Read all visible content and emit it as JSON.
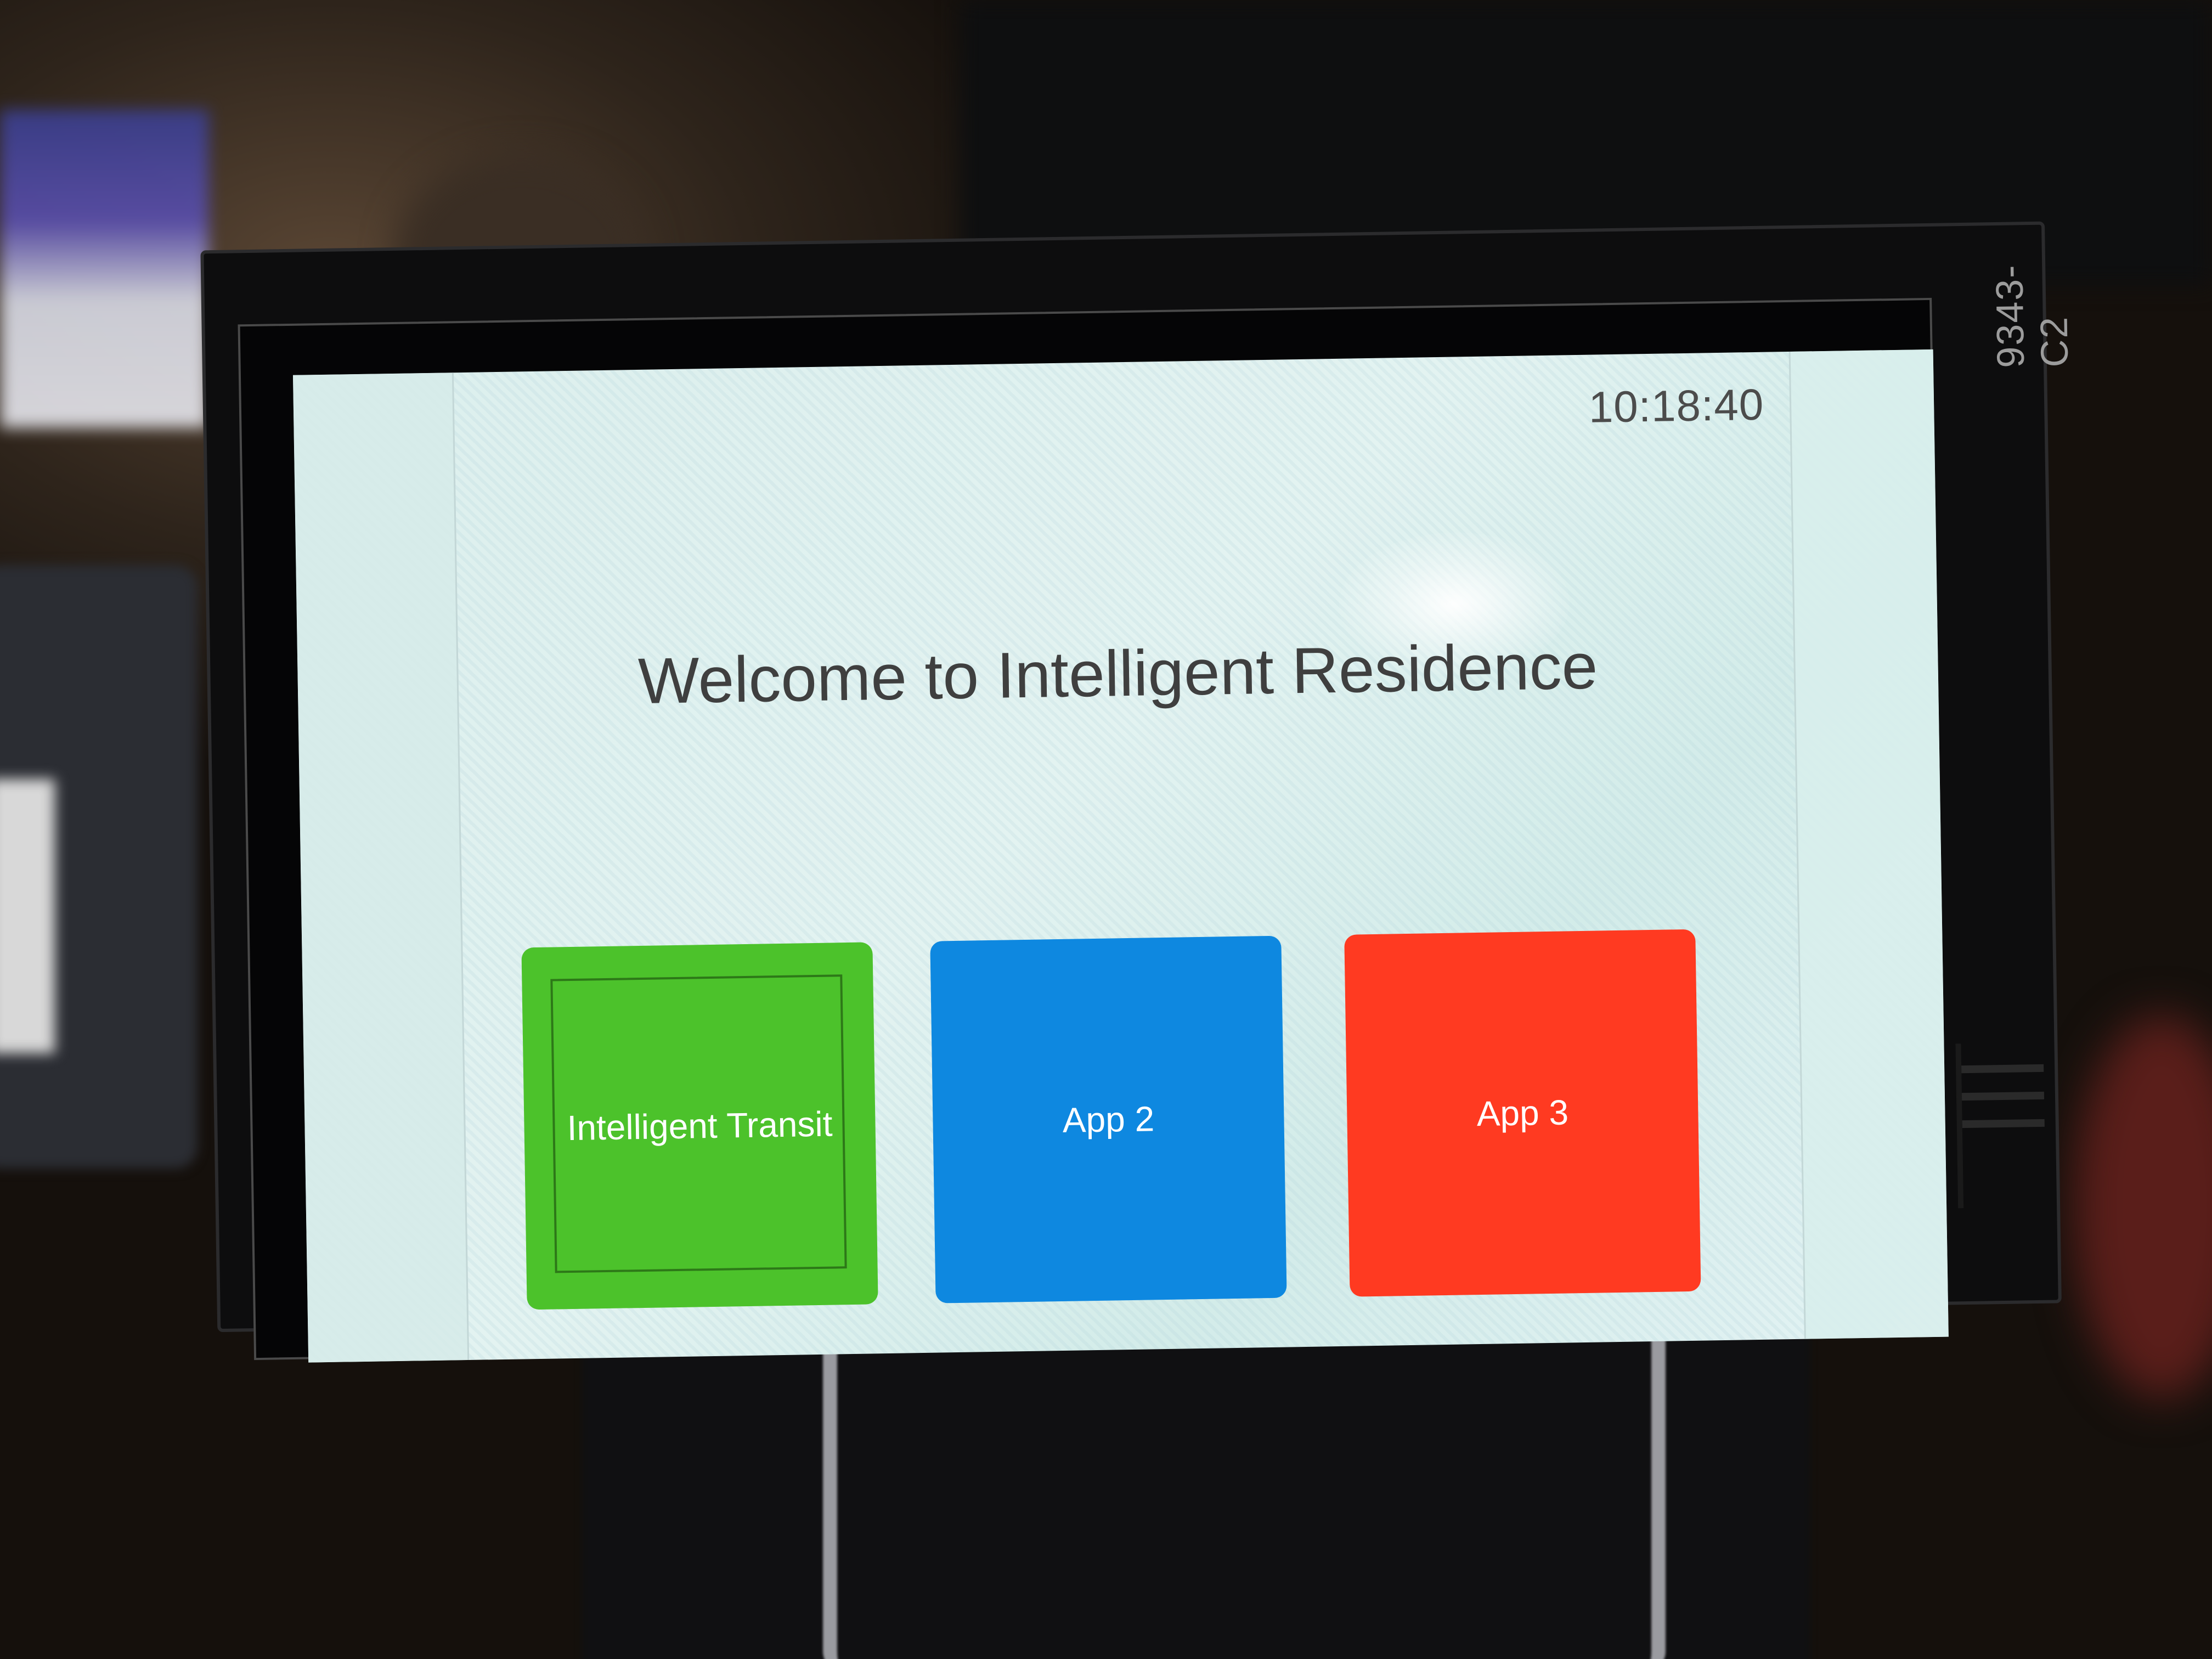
{
  "device": {
    "board_label": "9343-C2"
  },
  "screen": {
    "clock": "10:18:40",
    "welcome_text": "Welcome to Intelligent Residence",
    "apps": [
      {
        "label": "Intelligent Transit",
        "color": "#4cc22b",
        "focused": true
      },
      {
        "label": "App 2",
        "color": "#0e88e0",
        "focused": false
      },
      {
        "label": "App 3",
        "color": "#ff3a21",
        "focused": false
      }
    ]
  },
  "colors": {
    "screen_background": "#dcefed",
    "text": "#3f3f3f"
  }
}
